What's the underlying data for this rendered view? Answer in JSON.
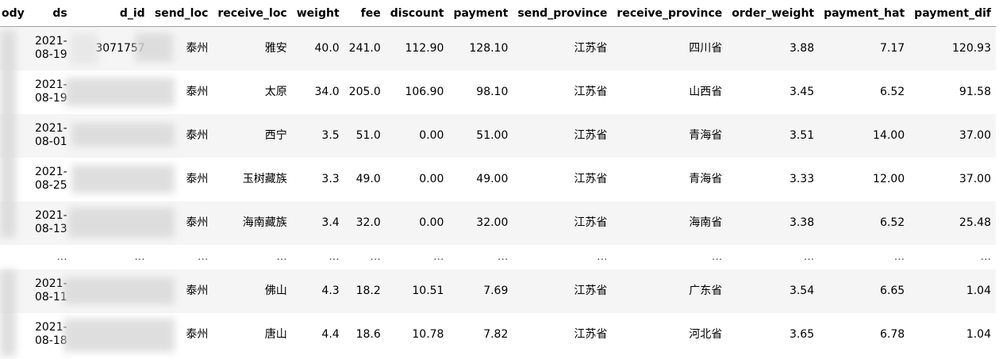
{
  "columns": [
    "body",
    "ds",
    "d_id",
    "send_loc",
    "receive_loc",
    "weight",
    "fee",
    "discount",
    "payment",
    "send_province",
    "receive_province",
    "order_weight",
    "payment_hat",
    "payment_dif"
  ],
  "header_labels": {
    "body": "ody",
    "ds": "ds",
    "d_id": "d_id",
    "send_loc": "send_loc",
    "receive_loc": "receive_loc",
    "weight": "weight",
    "fee": "fee",
    "discount": "discount",
    "payment": "payment",
    "send_province": "send_province",
    "receive_province": "receive_province",
    "order_weight": "order_weight",
    "payment_hat": "payment_hat",
    "payment_dif": "payment_dif"
  },
  "rows": [
    {
      "ds_year": "2021-",
      "ds_day": "08-19",
      "d_id": "3071757",
      "send_loc": "泰州",
      "receive_loc": "雅安",
      "weight": "40.0",
      "fee": "241.0",
      "discount": "112.90",
      "payment": "128.10",
      "send_province": "江苏省",
      "receive_province": "四川省",
      "order_weight": "3.88",
      "payment_hat": "7.17",
      "payment_dif": "120.93"
    },
    {
      "ds_year": "2021-",
      "ds_day": "08-19",
      "d_id": "",
      "send_loc": "泰州",
      "receive_loc": "太原",
      "weight": "34.0",
      "fee": "205.0",
      "discount": "106.90",
      "payment": "98.10",
      "send_province": "江苏省",
      "receive_province": "山西省",
      "order_weight": "3.45",
      "payment_hat": "6.52",
      "payment_dif": "91.58"
    },
    {
      "ds_year": "2021-",
      "ds_day": "08-01",
      "d_id": "",
      "send_loc": "泰州",
      "receive_loc": "西宁",
      "weight": "3.5",
      "fee": "51.0",
      "discount": "0.00",
      "payment": "51.00",
      "send_province": "江苏省",
      "receive_province": "青海省",
      "order_weight": "3.51",
      "payment_hat": "14.00",
      "payment_dif": "37.00"
    },
    {
      "ds_year": "2021-",
      "ds_day": "08-25",
      "d_id": "",
      "send_loc": "泰州",
      "receive_loc": "玉树藏族",
      "weight": "3.3",
      "fee": "49.0",
      "discount": "0.00",
      "payment": "49.00",
      "send_province": "江苏省",
      "receive_province": "青海省",
      "order_weight": "3.33",
      "payment_hat": "12.00",
      "payment_dif": "37.00"
    },
    {
      "ds_year": "2021-",
      "ds_day": "08-13",
      "d_id": "",
      "send_loc": "泰州",
      "receive_loc": "海南藏族",
      "weight": "3.4",
      "fee": "32.0",
      "discount": "0.00",
      "payment": "32.00",
      "send_province": "江苏省",
      "receive_province": "海南省",
      "order_weight": "3.38",
      "payment_hat": "6.52",
      "payment_dif": "25.48"
    }
  ],
  "ellipsis": "...",
  "tail_rows": [
    {
      "ds_year": "2021-",
      "ds_day": "08-11",
      "d_id": "",
      "send_loc": "泰州",
      "receive_loc": "佛山",
      "weight": "4.3",
      "fee": "18.2",
      "discount": "10.51",
      "payment": "7.69",
      "send_province": "江苏省",
      "receive_province": "广东省",
      "order_weight": "3.54",
      "payment_hat": "6.65",
      "payment_dif": "1.04"
    },
    {
      "ds_year": "2021-",
      "ds_day": "08-18",
      "d_id": "",
      "send_loc": "泰州",
      "receive_loc": "唐山",
      "weight": "4.4",
      "fee": "18.6",
      "discount": "10.78",
      "payment": "7.82",
      "send_province": "江苏省",
      "receive_province": "河北省",
      "order_weight": "3.65",
      "payment_hat": "6.78",
      "payment_dif": "1.04"
    }
  ]
}
